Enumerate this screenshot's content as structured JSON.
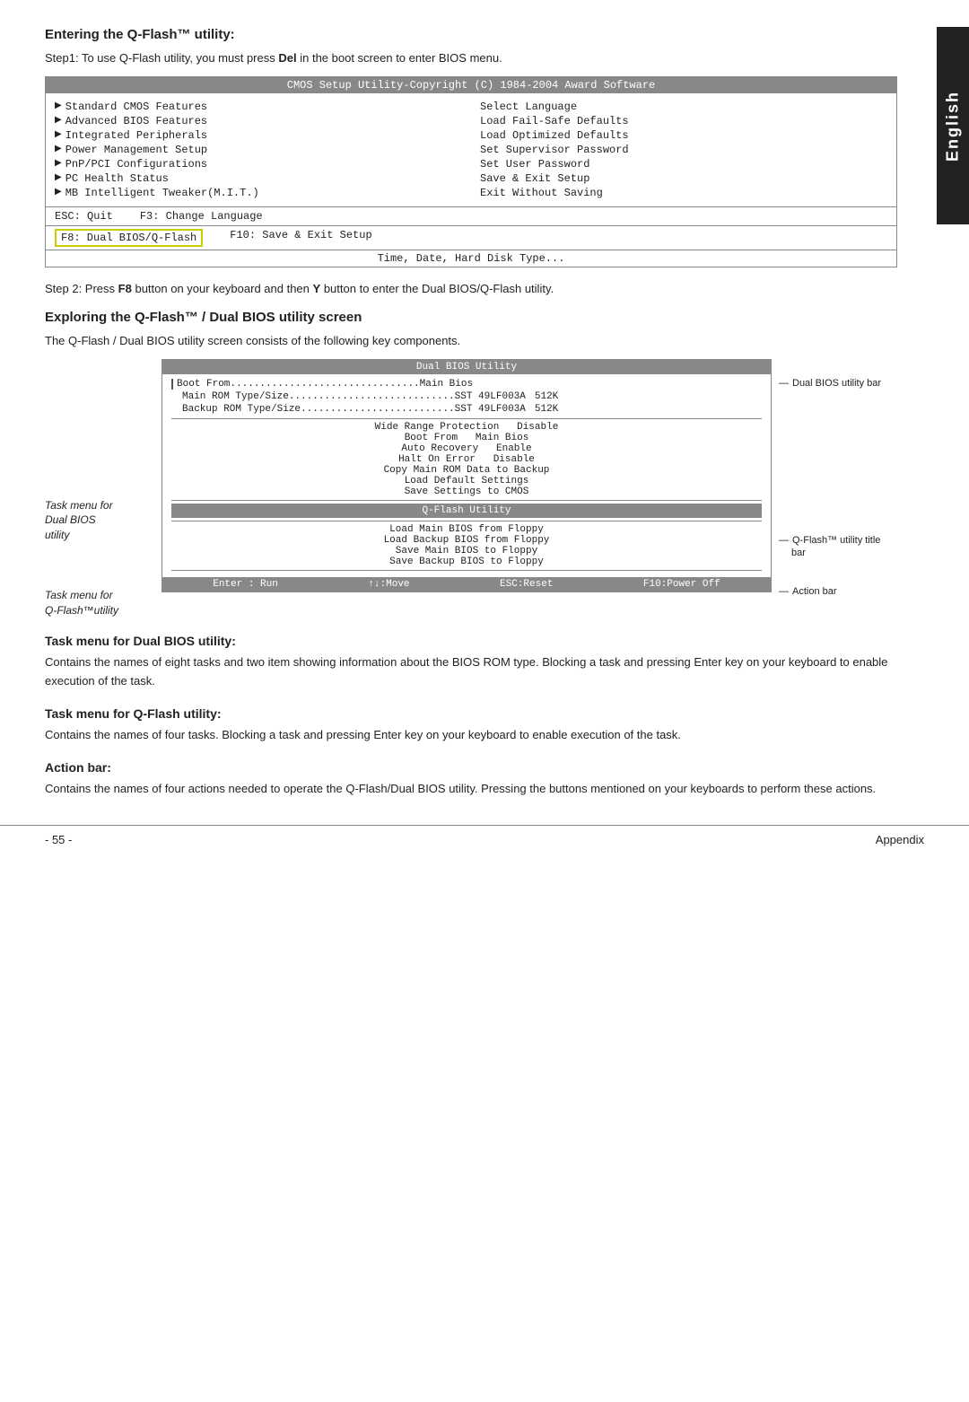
{
  "english_tab": "English",
  "section1": {
    "heading": "Entering the Q-Flash™ utility:",
    "step1": "Step1: To use Q-Flash utility, you must press",
    "step1_bold": "Del",
    "step1_rest": " in the boot screen to enter BIOS menu.",
    "bios_header": "CMOS Setup Utility-Copyright (C) 1984-2004 Award Software",
    "bios_left_items": [
      "Standard CMOS Features",
      "Advanced BIOS Features",
      "Integrated Peripherals",
      "Power Management Setup",
      "PnP/PCI Configurations",
      "PC Health Status",
      "MB Intelligent Tweaker(M.I.T.)"
    ],
    "bios_right_items": [
      "Select Language",
      "Load Fail-Safe Defaults",
      "Load Optimized Defaults",
      "Set Supervisor Password",
      "Set User Password",
      "Save & Exit Setup",
      "Exit Without Saving"
    ],
    "bios_footer1_left": "ESC: Quit",
    "bios_footer1_right": "F3: Change Language",
    "bios_footer2_left_highlight": "F8: Dual BIOS/Q-Flash",
    "bios_footer2_right": "F10: Save & Exit Setup",
    "bios_footer3": "Time, Date, Hard Disk Type...",
    "step2": "Step 2: Press",
    "step2_bold1": "F8",
    "step2_mid": " button on your keyboard and then",
    "step2_bold2": "Y",
    "step2_rest": " button to enter the Dual BIOS/Q-Flash utility."
  },
  "section2": {
    "heading": "Exploring the Q-Flash™ / Dual BIOS utility screen",
    "intro": "The Q-Flash / Dual BIOS utility screen consists of the following key components.",
    "dual_bios_title": "Dual BIOS Utility",
    "boot_from_label": "Boot From",
    "boot_from_value": "Main Bios",
    "main_rom_label": "Main ROM Type/Size",
    "main_rom_dots": "............................",
    "main_rom_value": "SST 49LF003A",
    "main_rom_size": "512K",
    "backup_rom_label": "Backup ROM Type/Size",
    "backup_rom_dots": "..........................",
    "backup_rom_value": "SST 49LF003A",
    "backup_rom_size": "512K",
    "task_items_dual": [
      "Wide Range Protection   Disable",
      "Boot From   Main Bios",
      "Auto Recovery   Enable",
      "Halt On Error   Disable",
      "Copy Main ROM Data to Backup",
      "Load Default Settings",
      "Save Settings to CMOS"
    ],
    "qflash_title": "Q-Flash Utility",
    "task_items_qflash": [
      "Load Main BIOS from Floppy",
      "Load Backup BIOS from Floppy",
      "Save Main BIOS to Floppy",
      "Save Backup BIOS to Floppy"
    ],
    "action_bar_items": [
      "Enter : Run",
      "↑↓:Move",
      "ESC:Reset",
      "F10:Power Off"
    ],
    "label_left_task_dual_title": "Task menu for",
    "label_left_task_dual_sub1": "Dual BIOS",
    "label_left_task_dual_sub2": "utility",
    "label_left_task_qflash_title": "Task menu for",
    "label_left_task_qflash_sub": "Q-Flash™utility",
    "label_right_dual_bar": "Dual BIOS utility bar",
    "label_right_qflash_title": "Q-Flash™ utility title",
    "label_right_qflash_sub": "bar",
    "label_right_action": "Action bar"
  },
  "section3": {
    "heading_dual": "Task menu for Dual BIOS utility:",
    "text_dual": "Contains the names of eight tasks and two item showing information about the BIOS ROM type. Blocking a task and pressing Enter key on your keyboard to enable execution of the task.",
    "heading_qflash": "Task menu for Q-Flash utility:",
    "text_qflash": "Contains the names of four tasks. Blocking a task and pressing Enter key on your keyboard to enable execution of the task.",
    "heading_action": "Action bar:",
    "text_action": "Contains the names of four actions needed to operate the Q-Flash/Dual BIOS utility. Pressing the buttons mentioned on your keyboards to perform these actions."
  },
  "footer": {
    "page_number": "- 55 -",
    "label": "Appendix"
  }
}
